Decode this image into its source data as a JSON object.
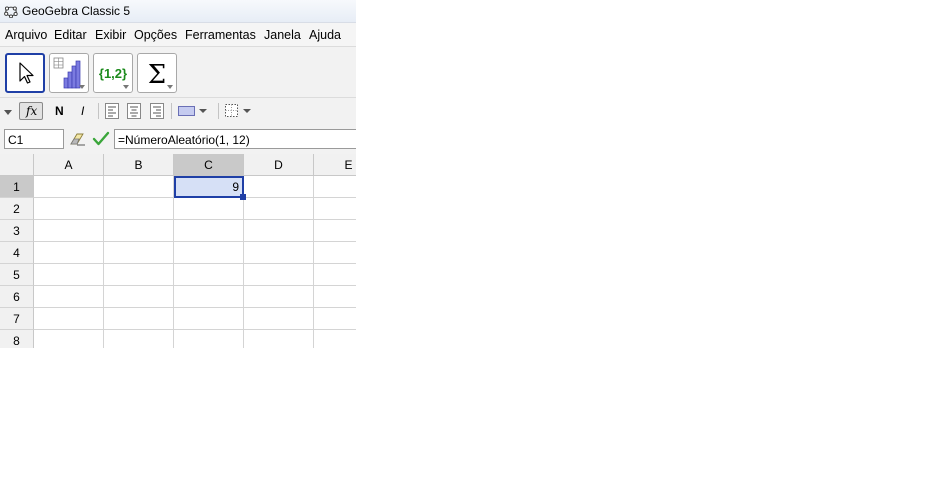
{
  "window": {
    "title": "GeoGebra Classic 5",
    "icon": "geogebra-logo-icon"
  },
  "menu": [
    "Arquivo",
    "Editar",
    "Exibir",
    "Opções",
    "Ferramentas",
    "Janela",
    "Ajuda"
  ],
  "toolbar": {
    "tools": [
      {
        "name": "move-tool",
        "icon": "cursor-arrow-icon",
        "selected": true
      },
      {
        "name": "one-variable-analysis-tool",
        "icon": "histogram-icon",
        "selected": false
      },
      {
        "name": "create-list-tool",
        "icon": "list-braces-icon",
        "label": "{1,2}",
        "selected": false
      },
      {
        "name": "sum-tool",
        "icon": "sigma-icon",
        "label": "Σ",
        "selected": false
      }
    ]
  },
  "stylebar": {
    "fx_label": "fx",
    "bold_label": "N",
    "italic_label": "I"
  },
  "input": {
    "cell_name": "C1",
    "formula": "=NúmeroAleatório(1, 12)"
  },
  "spreadsheet": {
    "columns": [
      "A",
      "B",
      "C",
      "D",
      "E"
    ],
    "rows": [
      "1",
      "2",
      "3",
      "4",
      "5",
      "6",
      "7",
      "8"
    ],
    "selected_cell": "C1",
    "cells": {
      "C1": "9"
    },
    "colors": {
      "selection_border": "#1f3fa6",
      "selection_fill": "#d6e0f6"
    }
  }
}
